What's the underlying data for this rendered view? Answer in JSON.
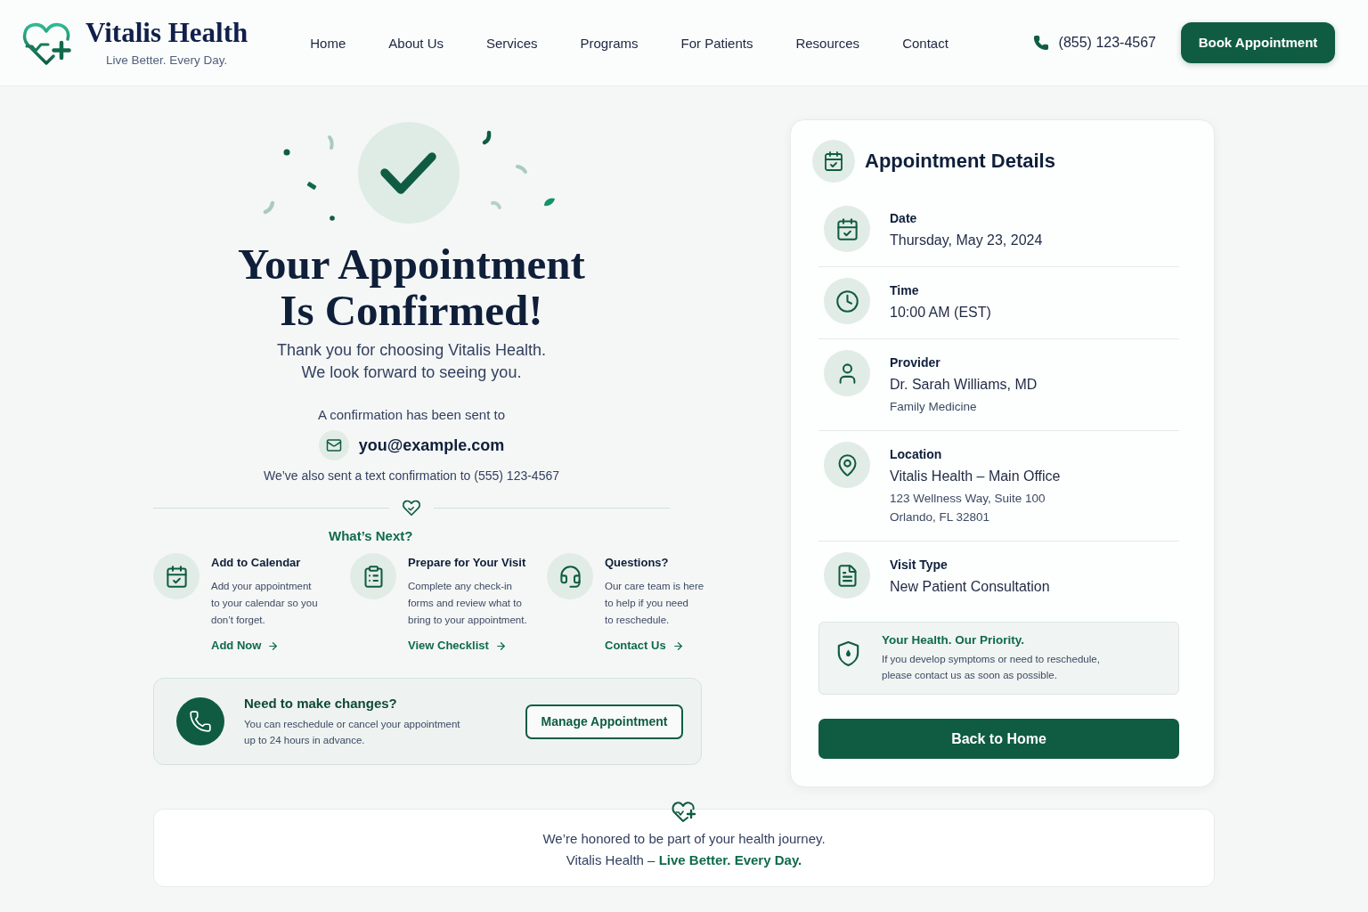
{
  "header": {
    "logo": {
      "name": "Vitalis Health",
      "tagline": "Live Better. Every Day."
    },
    "nav": [
      "Home",
      "About Us",
      "Services",
      "Programs",
      "For Patients",
      "Resources",
      "Contact"
    ],
    "phone": "(855) 123-4567",
    "cta": "Book Appointment"
  },
  "confirmation": {
    "title": [
      "Your Appointment",
      "Is Confirmed!"
    ],
    "message": [
      "Thank you for choosing Vitalis Health.",
      "We look forward to seeing you."
    ],
    "sent_to": "A confirmation has been sent to",
    "email": "you@example.com",
    "text_note": "We’ve also sent a text confirmation to (555) 123-4567"
  },
  "whats_next": {
    "title": "What’s Next?",
    "steps": [
      {
        "kind": "calendar",
        "title": "Add to Calendar",
        "text": [
          "Add your appointment",
          "to your calendar so you",
          "don’t forget."
        ],
        "link": "Add Now"
      },
      {
        "kind": "checklist",
        "title": "Prepare for Your Visit",
        "text": [
          "Complete any check-in",
          "forms and review what to",
          "bring to your appointment."
        ],
        "link": "View Checklist"
      },
      {
        "kind": "support",
        "title": "Questions?",
        "text": [
          "Our care team is here",
          "to help if you need",
          "to reschedule."
        ],
        "link": "Contact Us"
      }
    ]
  },
  "changes": {
    "title": "Need to make changes?",
    "text": [
      "You can reschedule or cancel your appointment",
      "up to 24 hours in advance."
    ],
    "button": "Manage Appointment"
  },
  "details": {
    "title": "Appointment Details",
    "rows": [
      {
        "kind": "date",
        "label": "Date",
        "value": "Thursday, May 23, 2024"
      },
      {
        "kind": "time",
        "label": "Time",
        "value": "10:00 AM (EST)"
      },
      {
        "kind": "provider",
        "label": "Provider",
        "value": "Dr. Sarah Williams, MD",
        "notes": [
          "Family Medicine"
        ]
      },
      {
        "kind": "location",
        "label": "Location",
        "value": "Vitalis Health – Main Office",
        "notes": [
          "123 Wellness Way, Suite 100",
          "Orlando, FL 32801"
        ]
      },
      {
        "kind": "visit_type",
        "label": "Visit Type",
        "value": "New Patient Consultation"
      }
    ],
    "notice": {
      "title": "Your Health. Our Priority.",
      "text": [
        "If you develop symptoms or need to reschedule,",
        "please contact us as soon as possible."
      ]
    },
    "button": "Back to Home"
  },
  "footer": {
    "lines": [
      "We’re honored to be part of your health journey.",
      "Vitalis Health – **Live Better. Every Day.**"
    ]
  }
}
